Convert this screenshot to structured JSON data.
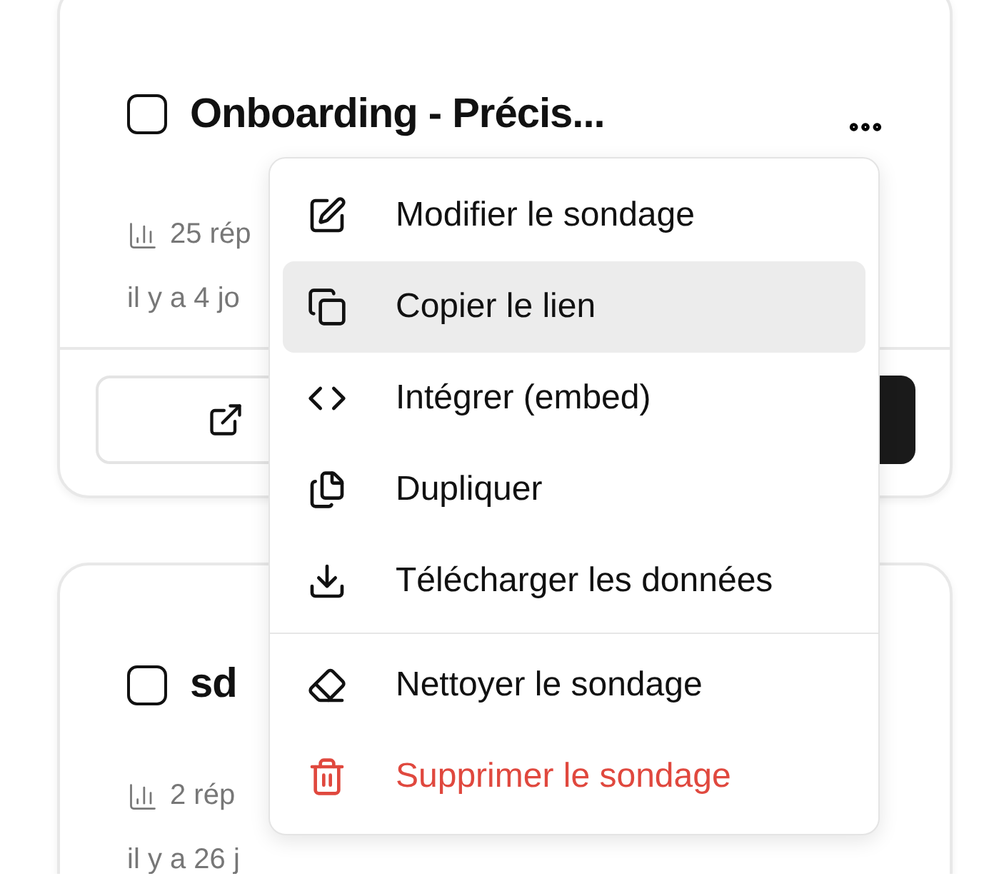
{
  "surveys": [
    {
      "title": "Onboarding - Précis...",
      "checked": false,
      "responses": "25 rép",
      "date": "il y a 4 jo",
      "footer_buttons": [
        {
          "kind": "outline"
        },
        {
          "kind": "dark"
        }
      ]
    },
    {
      "title": "sd",
      "checked": false,
      "responses": "2 rép",
      "date": "il y a 26 j"
    }
  ],
  "menu": {
    "groups": [
      [
        {
          "label": "Modifier le sondage",
          "highlighted": false,
          "kind": "default"
        },
        {
          "label": "Copier le lien",
          "highlighted": true,
          "kind": "default"
        },
        {
          "label": "Intégrer (embed)",
          "highlighted": false,
          "kind": "default"
        },
        {
          "label": "Dupliquer",
          "highlighted": false,
          "kind": "default"
        },
        {
          "label": "Télécharger les données",
          "highlighted": false,
          "kind": "default"
        }
      ],
      [
        {
          "label": "Nettoyer le sondage",
          "highlighted": false,
          "kind": "default"
        },
        {
          "label": "Supprimer le sondage",
          "highlighted": false,
          "kind": "danger"
        }
      ]
    ]
  }
}
